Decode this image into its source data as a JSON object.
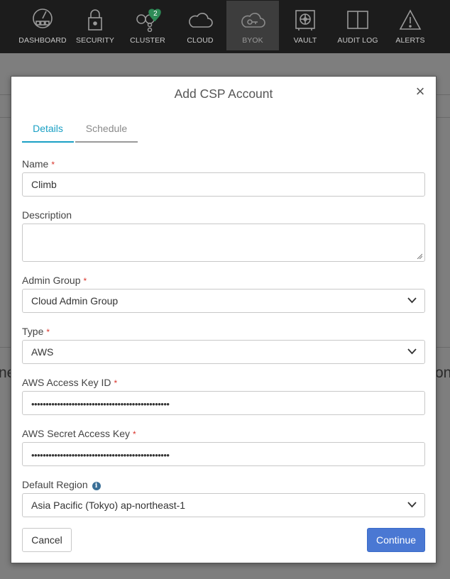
{
  "nav": {
    "items": [
      {
        "label": "DASHBOARD",
        "icon": "dashboard-icon"
      },
      {
        "label": "SECURITY",
        "icon": "lock-icon"
      },
      {
        "label": "CLUSTER",
        "icon": "cluster-icon",
        "badge": "2"
      },
      {
        "label": "CLOUD",
        "icon": "cloud-icon"
      },
      {
        "label": "BYOK",
        "icon": "cloud-key-icon",
        "active": true
      },
      {
        "label": "VAULT",
        "icon": "vault-icon"
      },
      {
        "label": "AUDIT LOG",
        "icon": "book-icon"
      },
      {
        "label": "ALERTS",
        "icon": "warning-icon"
      }
    ]
  },
  "background": {
    "left_fragment": "ne",
    "right_fragment": "on"
  },
  "modal": {
    "title": "Add CSP Account",
    "close_symbol": "×",
    "tabs": [
      {
        "label": "Details",
        "active": true
      },
      {
        "label": "Schedule",
        "active": false
      }
    ],
    "fields": {
      "name": {
        "label": "Name",
        "required": "*",
        "value": "Climb"
      },
      "description": {
        "label": "Description",
        "value": ""
      },
      "admin_group": {
        "label": "Admin Group",
        "required": "*",
        "value": "Cloud Admin Group"
      },
      "type": {
        "label": "Type",
        "required": "*",
        "value": "AWS"
      },
      "access_key": {
        "label": "AWS Access Key ID",
        "required": "*",
        "value": "••••••••••••••••••••••••••••••••••••••••••••••••"
      },
      "secret_key": {
        "label": "AWS Secret Access Key",
        "required": "*",
        "value": "••••••••••••••••••••••••••••••••••••••••••••••••"
      },
      "region": {
        "label": "Default Region",
        "info": "i",
        "value": "Asia Pacific (Tokyo) ap-northeast-1"
      }
    },
    "buttons": {
      "cancel": "Cancel",
      "continue": "Continue"
    }
  },
  "colors": {
    "nav_bg": "#1c1c1c",
    "accent": "#1aa0c4",
    "primary_button": "#4a78d3",
    "required": "#d9342b",
    "badge": "#2e8b57"
  }
}
